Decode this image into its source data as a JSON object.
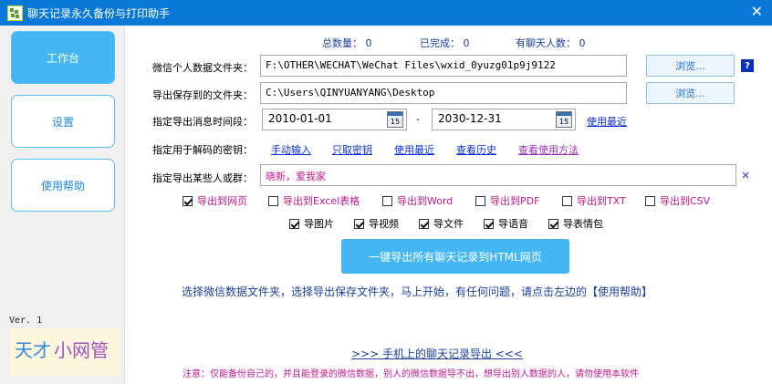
{
  "window": {
    "title": "聊天记录永久备份与打印助手",
    "close_glyph": "✕"
  },
  "sidebar": {
    "items": [
      {
        "label": "工作台",
        "active": true
      },
      {
        "label": "设置",
        "active": false
      },
      {
        "label": "使用帮助",
        "active": false
      }
    ],
    "version": "Ver. 1",
    "logo": {
      "part1": "天才",
      "part2": "小网管"
    }
  },
  "stats": {
    "total_label": "总数量：",
    "total_value": "0",
    "done_label": "已完成：",
    "done_value": "0",
    "contacts_label": "有聊天人数：",
    "contacts_value": "0"
  },
  "wechat_folder": {
    "label": "微信个人数据文件夹：",
    "value": "F:\\OTHER\\WECHAT\\WeChat Files\\wxid_0yuzg01p9j9122",
    "browse_label": "浏览...",
    "help_label": "?"
  },
  "save_folder": {
    "label": "导出保存到的文件夹：",
    "value": "C:\\Users\\QINYUANYANG\\Desktop",
    "browse_label": "浏览..."
  },
  "date_range": {
    "label": "指定导出消息时间段：",
    "start": "2010-01-01",
    "separator": "-",
    "end": "2030-12-31",
    "recent_link": "使用最近",
    "calendar_glyph": "15"
  },
  "decrypt_key": {
    "label": "指定用于解码的密钥：",
    "links": [
      "手动输入",
      "只取密钥",
      "使用最近",
      "查看历史",
      "查看使用方法"
    ]
  },
  "contacts": {
    "label": "指定导出某些人或群：",
    "value": "晓新，爱我家",
    "clear_glyph": "×"
  },
  "export_formats": [
    {
      "label": "导出到网页",
      "checked": true
    },
    {
      "label": "导出到Excel表格",
      "checked": false
    },
    {
      "label": "导出到Word",
      "checked": false
    },
    {
      "label": "导出到PDF",
      "checked": false
    },
    {
      "label": "导出到TXT",
      "checked": false
    },
    {
      "label": "导出到CSV",
      "checked": false
    }
  ],
  "media_options": [
    {
      "label": "导图片",
      "checked": true
    },
    {
      "label": "导视频",
      "checked": true
    },
    {
      "label": "导文件",
      "checked": true
    },
    {
      "label": "导语音",
      "checked": true
    },
    {
      "label": "导表情包",
      "checked": true
    }
  ],
  "main_button": "一键导出所有聊天记录到HTML网页",
  "hint": "选择微信数据文件夹，选择导出保存文件夹，马上开始，有任何问题，请点击左边的【使用帮助】",
  "mobile_link": ">>>  手机上的聊天记录导出  <<<",
  "note": "注意：仅能备份自己的，并且能登录的微信数据，别人的微信数据导不出，想导出别人数据的人，请勿使用本软件",
  "colors": {
    "titlebar": "#0a78d6",
    "accent": "#45b6f4",
    "option_text": "#c0198f",
    "link": "#0a2fd6",
    "stat_text": "#1a3f9c"
  }
}
